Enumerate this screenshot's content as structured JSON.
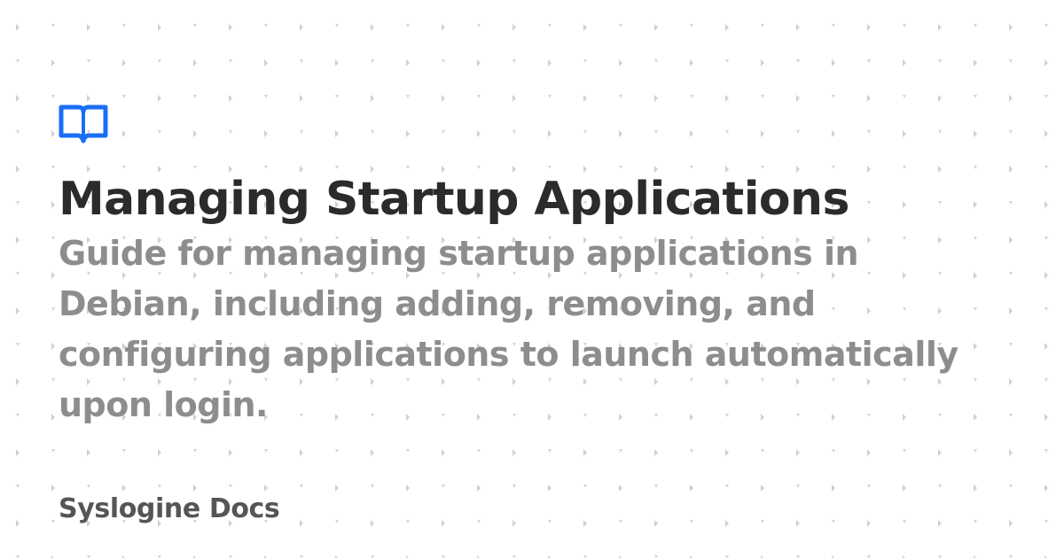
{
  "brand": {
    "logo_icon": "book-open-icon",
    "accent_color": "#1a6ef5"
  },
  "content": {
    "title": "Managing Startup Applications",
    "description": "Guide for managing startup applications in Debian, including adding, removing, and configuring applications to launch automatically upon login.",
    "site_name": "Syslogine Docs"
  },
  "colors": {
    "background": "#ffffff",
    "title": "#2b2b2b",
    "description": "#8d8d8d",
    "site_name": "#555555",
    "pattern_dots": "#cfcfcf"
  }
}
